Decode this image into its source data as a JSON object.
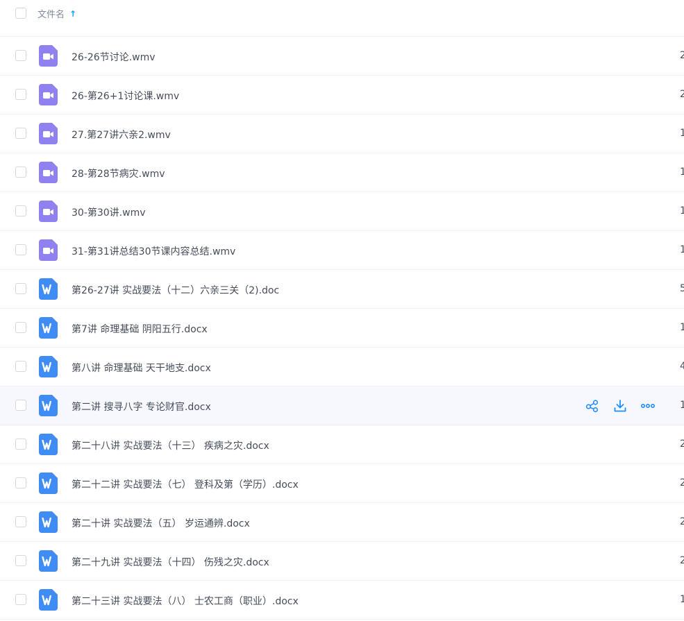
{
  "header": {
    "name_label": "文件名",
    "sort_icon": "arrow-up-icon"
  },
  "colors": {
    "accent": "#06a7ff",
    "video_icon": "#8f82f0",
    "doc_icon": "#3f8cf4",
    "hover_row": "#f6f8fe",
    "action_icon": "#1f8cff"
  },
  "files": [
    {
      "name": "26-26节讨论.wmv",
      "type": "video",
      "size": "2"
    },
    {
      "name": "26-第26+1讨论课.wmv",
      "type": "video",
      "size": "2"
    },
    {
      "name": "27.第27讲六亲2.wmv",
      "type": "video",
      "size": "1"
    },
    {
      "name": "28-第28节病灾.wmv",
      "type": "video",
      "size": "1"
    },
    {
      "name": "30-第30讲.wmv",
      "type": "video",
      "size": "1"
    },
    {
      "name": "31-第31讲总结30节课内容总结.wmv",
      "type": "video",
      "size": "1"
    },
    {
      "name": "第26-27讲 实战要法（十二）六亲三关（2).doc",
      "type": "doc",
      "size": "5"
    },
    {
      "name": "第7讲 命理基础 阴阳五行.docx",
      "type": "doc",
      "size": "1"
    },
    {
      "name": "第八讲 命理基础 天干地支.docx",
      "type": "doc",
      "size": "4"
    },
    {
      "name": "第二讲 搜寻八字 专论财官.docx",
      "type": "doc",
      "size": "1",
      "hovered": true
    },
    {
      "name": "第二十八讲 实战要法（十三） 疾病之灾.docx",
      "type": "doc",
      "size": "2"
    },
    {
      "name": "第二十二讲 实战要法（七） 登科及第（学历）.docx",
      "type": "doc",
      "size": "2"
    },
    {
      "name": "第二十讲 实战要法（五） 岁运通辨.docx",
      "type": "doc",
      "size": "2"
    },
    {
      "name": "第二十九讲 实战要法（十四） 伤残之灾.docx",
      "type": "doc",
      "size": "2"
    },
    {
      "name": "第二十三讲 实战要法（八） 士农工商（职业）.docx",
      "type": "doc",
      "size": "1"
    }
  ],
  "row_actions": [
    "share-icon",
    "download-icon",
    "more-icon"
  ]
}
